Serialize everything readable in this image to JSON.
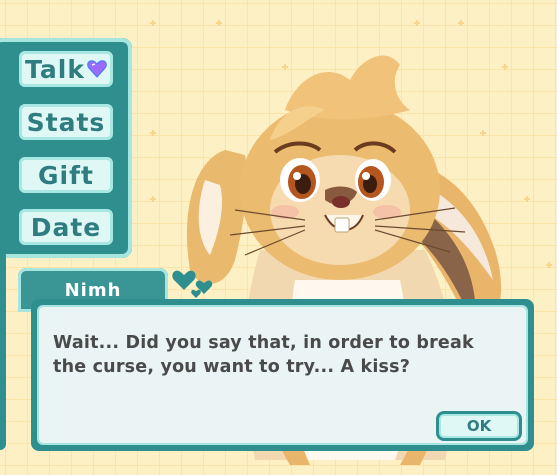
{
  "menu": {
    "items": [
      {
        "label": "Talk",
        "icon": "heart-gem-icon"
      },
      {
        "label": "Stats"
      },
      {
        "label": "Gift"
      },
      {
        "label": "Date"
      }
    ]
  },
  "dialog": {
    "speaker": "Nimh",
    "text": "Wait... Did you say that, in order to break the curse, you want to try... A kiss?",
    "ok_label": "OK"
  },
  "colors": {
    "panel_teal": "#2f8f8e",
    "panel_light": "#a6e5e0",
    "background": "#fdf0c4",
    "button_text": "#2f7d80"
  }
}
